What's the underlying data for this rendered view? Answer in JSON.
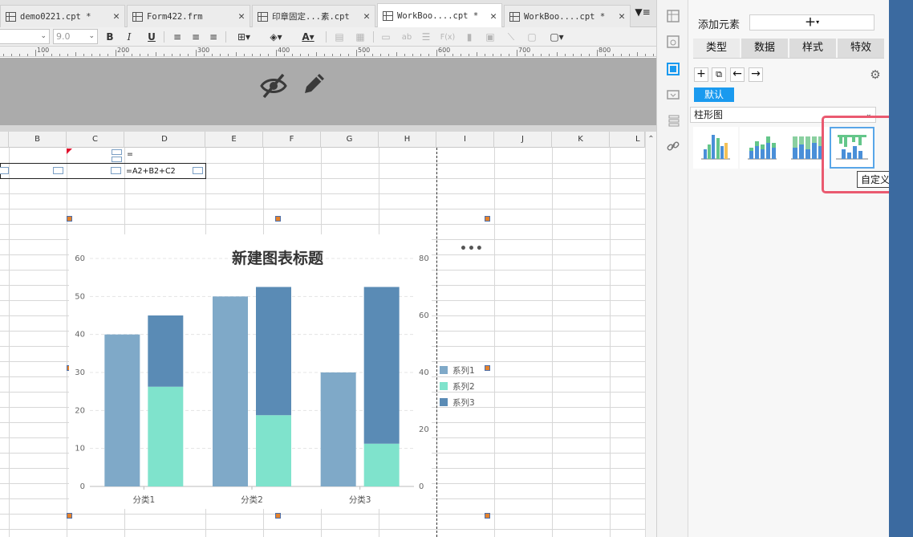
{
  "tabs": [
    {
      "label": "demo0221.cpt *",
      "active": false
    },
    {
      "label": "Form422.frm",
      "active": false
    },
    {
      "label": "印章固定...素.cpt",
      "active": false
    },
    {
      "label": "WorkBoo....cpt *",
      "active": true
    },
    {
      "label": "WorkBoo....cpt *",
      "active": false
    }
  ],
  "toolbar": {
    "font_size": "9.0",
    "bold": "B",
    "italic": "I",
    "underline": "U",
    "font_color_glyph": "A",
    "text_glyph": "ab",
    "formula_glyph": "F(x)"
  },
  "ruler": {
    "labels": [
      "100",
      "200",
      "300",
      "400",
      "500",
      "600",
      "700",
      "800"
    ]
  },
  "sheet": {
    "columns": [
      "B",
      "C",
      "D",
      "E",
      "F",
      "G",
      "H",
      "I",
      "J",
      "K",
      "L"
    ],
    "cell_d1": "=",
    "cell_d2": "=A2+B2+C2"
  },
  "chart_data": {
    "type": "bar",
    "title": "新建图表标题",
    "categories": [
      "分类1",
      "分类2",
      "分类3"
    ],
    "series": [
      {
        "name": "系列1",
        "values": [
          40,
          50,
          30
        ],
        "axis": "left",
        "color": "#7fa9c8"
      },
      {
        "name": "系列2",
        "values": [
          35,
          25,
          15
        ],
        "axis": "right",
        "stack": "s",
        "color": "#7fe3cc"
      },
      {
        "name": "系列3",
        "values": [
          25,
          45,
          55
        ],
        "axis": "right",
        "stack": "s",
        "color": "#5a8bb5"
      }
    ],
    "y_left": {
      "min": 0,
      "max": 60,
      "ticks": [
        "0",
        "10",
        "20",
        "30",
        "40",
        "50",
        "60"
      ]
    },
    "y_right": {
      "min": 0,
      "max": 80,
      "ticks": [
        "0",
        "20",
        "40",
        "60",
        "80"
      ]
    },
    "legend_position": "right",
    "grid": true
  },
  "chart_more": "•••",
  "panel": {
    "add_element_label": "添加元素",
    "add_button": "+",
    "add_button_caret": "▾",
    "tabs": [
      "类型",
      "数据",
      "样式",
      "特效"
    ],
    "active_tab": "类型",
    "default_badge": "默认",
    "chart_type": "柱形图",
    "tooltip": "自定义",
    "thumbnails": [
      "clustered-bar-thumb",
      "stacked-bar-thumb",
      "percent-bar-thumb",
      "custom-bar-thumb"
    ],
    "selected_thumbnail": "custom-bar-thumb"
  },
  "colors": {
    "accent": "#1a9aef",
    "highlight": "#ea5a70",
    "series1": "#7fa9c8",
    "series2": "#7fe3cc",
    "series3": "#5a8bb5"
  }
}
